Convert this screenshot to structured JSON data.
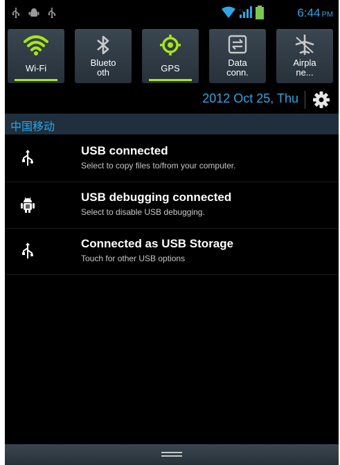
{
  "status_bar": {
    "left_icons": [
      "usb-icon",
      "android-debug-icon",
      "usb-icon"
    ],
    "right_icons": [
      "wifi-icon",
      "signal-icon",
      "battery-icon"
    ],
    "time": "6:44",
    "ampm": "PM",
    "accent_color": "#2fa6e6"
  },
  "quick_settings": {
    "active_color": "#a8e61a",
    "tiles": [
      {
        "label": "Wi-Fi",
        "icon": "wifi-icon",
        "active": true
      },
      {
        "label_line1": "Blueto",
        "label_line2": "oth",
        "icon": "bluetooth-icon",
        "active": false
      },
      {
        "label": "GPS",
        "icon": "gps-icon",
        "active": true
      },
      {
        "label_line1": "Data",
        "label_line2": "conn.",
        "icon": "data-connection-icon",
        "active": false
      },
      {
        "label_line1": "Airpla",
        "label_line2": "ne...",
        "icon": "airplane-icon",
        "active": false
      }
    ]
  },
  "date": "2012 Oct 25, Thu",
  "settings_icon": "gear-icon",
  "carrier": "中国移动",
  "notifications": [
    {
      "title": "USB connected",
      "subtitle": "Select to copy files to/from your computer.",
      "icon": "usb-icon"
    },
    {
      "title": "USB debugging connected",
      "subtitle": "Select to disable USB debugging.",
      "icon": "android-debug-icon"
    },
    {
      "title": "Connected as USB Storage",
      "subtitle": "Touch for other USB options",
      "icon": "usb-icon"
    }
  ],
  "handle_icon": "drag-handle-icon"
}
